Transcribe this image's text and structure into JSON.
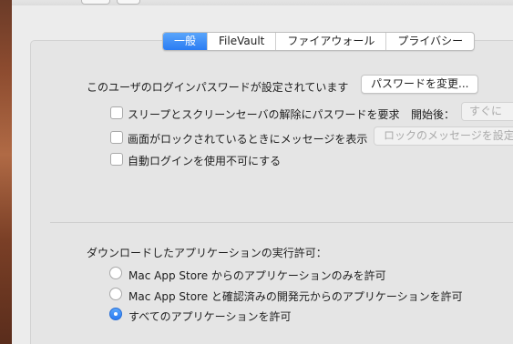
{
  "tabs": [
    {
      "label": "一般",
      "active": true
    },
    {
      "label": "FileVault",
      "active": false
    },
    {
      "label": "ファイアウォール",
      "active": false
    },
    {
      "label": "プライバシー",
      "active": false
    }
  ],
  "general": {
    "password_status": "このユーザのログインパスワードが設定されています",
    "change_password_button": "パスワードを変更...",
    "require_password": {
      "label": "スリープとスクリーンセーバの解除にパスワードを要求",
      "checked": false,
      "after_label": "開始後：",
      "after_value": "すぐに"
    },
    "lock_message": {
      "label": "画面がロックされているときにメッセージを表示",
      "checked": false,
      "button": "ロックのメッセージを設定"
    },
    "disable_auto_login": {
      "label": "自動ログインを使用不可にする",
      "checked": false
    }
  },
  "downloads": {
    "heading": "ダウンロードしたアプリケーションの実行許可：",
    "options": [
      {
        "label": "Mac App Store からのアプリケーションのみを許可",
        "selected": false
      },
      {
        "label": "Mac App Store と確認済みの開発元からのアプリケーションを許可",
        "selected": false
      },
      {
        "label": "すべてのアプリケーションを許可",
        "selected": true
      }
    ]
  },
  "colors": {
    "accent": "#2a7cf3",
    "background": "#ececec"
  }
}
